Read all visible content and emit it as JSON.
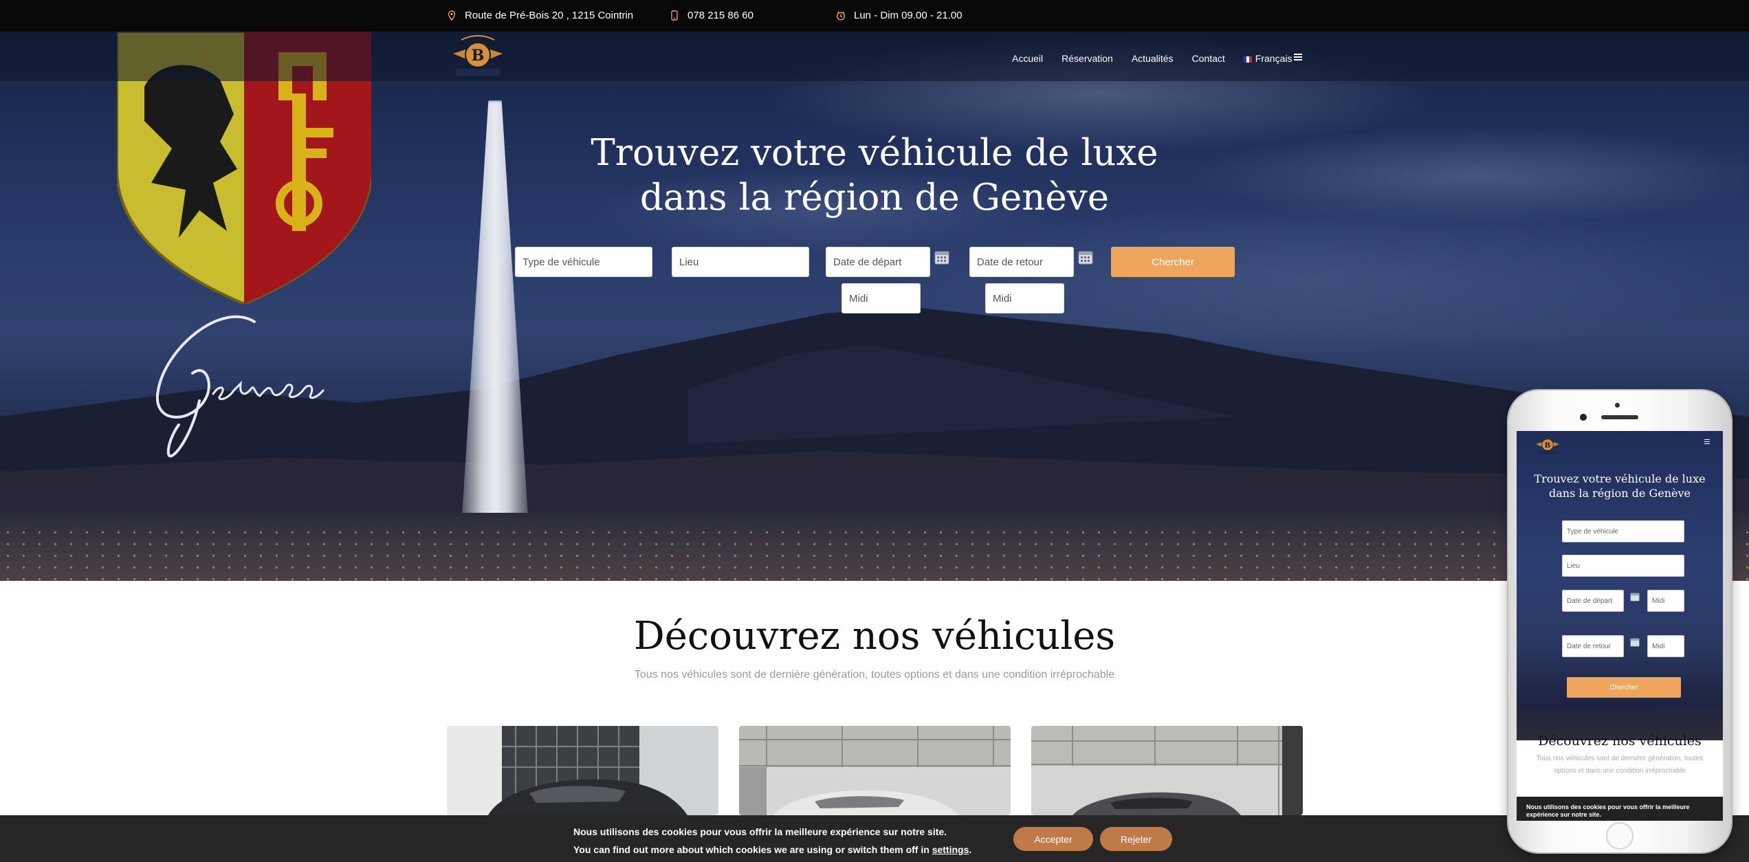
{
  "topbar": {
    "address": "Route de Pré-Bois 20 , 1215 Cointrin",
    "phone": "078 215 86 60",
    "hours": "Lun - Dim 09.00 - 21.00"
  },
  "nav": {
    "items": [
      "Accueil",
      "Réservation",
      "Actualités",
      "Contact"
    ],
    "language": "Français"
  },
  "hero": {
    "title_line1": "Trouvez votre véhicule de luxe",
    "title_line2": "dans la région de Genève",
    "script_text": "Geneva"
  },
  "search": {
    "vehicle_type_placeholder": "Type de véhicule",
    "location_placeholder": "Lieu",
    "departure_date_placeholder": "Date de départ",
    "return_date_placeholder": "Date de retour",
    "departure_time": "Midi",
    "return_time": "Midi",
    "submit_label": "Chercher"
  },
  "vehicles": {
    "title": "Découvrez nos véhicules",
    "subtitle": "Tous nos véhicules sont de dernière génération, toutes options et dans une condition irréprochable"
  },
  "cookie": {
    "line1": "Nous utilisons des cookies pour vous offrir la meilleure expérience sur notre site.",
    "line2_prefix": "You can find out more about which cookies we are using or switch them off in ",
    "line2_link": "settings",
    "line2_suffix": ".",
    "accept_label": "Accepter",
    "reject_label": "Rejeter"
  },
  "mobile_preview": {
    "title_line1": "Trouvez votre véhicule de luxe",
    "title_line2": "dans la région de Genève",
    "vehicle_type_placeholder": "Type de véhicule",
    "location_placeholder": "Lieu",
    "departure_date_placeholder": "Date de départ",
    "return_date_placeholder": "Date de retour",
    "departure_time": "Midi",
    "return_time": "Midi",
    "submit_label": "Chercher",
    "section_title": "Découvrez nos véhicules",
    "section_subtitle": "Tous nos véhicules sont de dernière génération, toutes options et dans une condition irréprochable",
    "cookie_text": "Nous utilisons des cookies pour vous offrir la meilleure expérience sur notre site."
  },
  "colors": {
    "accent_orange": "#f0a55c",
    "cookie_button": "#c07a4a",
    "topbar_bg": "#080808",
    "icon_orange": "#e8a04c"
  },
  "icons": {
    "address": "map-pin-icon",
    "phone": "mobile-phone-icon",
    "hours": "clock-icon",
    "calendar": "calendar-icon",
    "menu": "hamburger-icon"
  }
}
